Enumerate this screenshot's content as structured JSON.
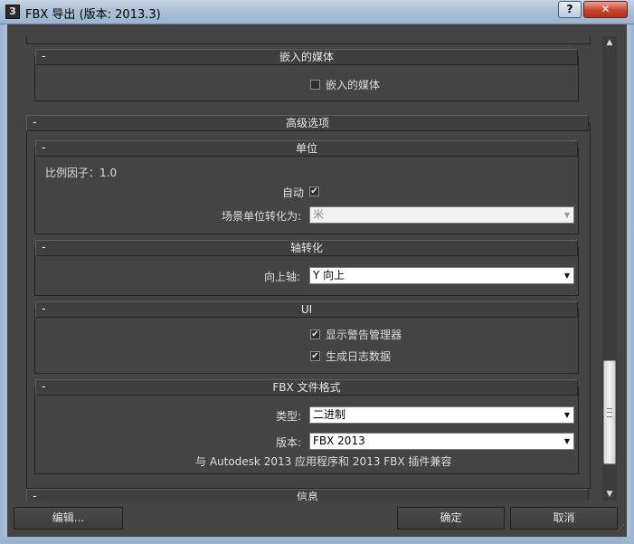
{
  "window": {
    "title": "FBX 导出 (版本: 2013.3)",
    "help_label": "?",
    "close_label": "✕"
  },
  "sections": {
    "embedded_media": {
      "title": "嵌入的媒体",
      "checkbox_label": "嵌入的媒体",
      "checked": false
    },
    "advanced": {
      "title": "高级选项"
    },
    "units": {
      "title": "单位",
      "scale_factor_label": "比例因子：1.0",
      "auto_label": "自动",
      "auto_checked": true,
      "convert_label": "场景单位转化为:",
      "convert_value": "米"
    },
    "axis": {
      "title": "轴转化",
      "up_axis_label": "向上轴:",
      "up_axis_value": "Y 向上"
    },
    "ui": {
      "title": "UI",
      "show_warnings_label": "显示警告管理器",
      "generate_log_label": "生成日志数据",
      "show_warnings_checked": true,
      "generate_log_checked": true
    },
    "fbx_format": {
      "title": "FBX 文件格式",
      "type_label": "类型:",
      "type_value": "二进制",
      "version_label": "版本:",
      "version_value": "FBX 2013",
      "compat_note": "与 Autodesk 2013 应用程序和 2013 FBX 插件兼容"
    },
    "info": {
      "title": "信息"
    }
  },
  "collapse_glyph": "-",
  "check_glyph": "✔",
  "buttons": {
    "edit": "编辑...",
    "ok": "确定",
    "cancel": "取消"
  },
  "colors": {
    "panel_bg": "#444444",
    "title_bar": "#a9bfd6",
    "close_red": "#c7432d"
  }
}
